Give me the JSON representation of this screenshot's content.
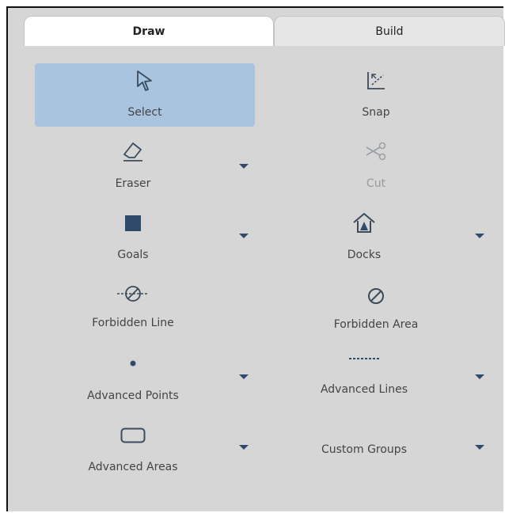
{
  "tabs": [
    {
      "label": "Draw",
      "active": true
    },
    {
      "label": "Build",
      "active": false
    }
  ],
  "tools": {
    "select": {
      "label": "Select",
      "icon": "cursor-arrow-icon",
      "selected": true
    },
    "snap": {
      "label": "Snap",
      "icon": "snap-icon"
    },
    "eraser": {
      "label": "Eraser",
      "icon": "eraser-icon",
      "has_dropdown": true
    },
    "cut": {
      "label": "Cut",
      "icon": "scissors-icon",
      "disabled": true
    },
    "goals": {
      "label": "Goals",
      "icon": "square-icon",
      "has_dropdown": true
    },
    "docks": {
      "label": "Docks",
      "icon": "dock-house-icon",
      "has_dropdown": true
    },
    "forbidden_line": {
      "label": "Forbidden Line",
      "icon": "forbidden-line-icon"
    },
    "forbidden_area": {
      "label": "Forbidden Area",
      "icon": "forbidden-area-icon"
    },
    "advanced_points": {
      "label": "Advanced Points",
      "icon": "point-icon",
      "has_dropdown": true
    },
    "advanced_lines": {
      "label": "Advanced Lines",
      "icon": "dashed-line-icon",
      "has_dropdown": true
    },
    "advanced_areas": {
      "label": "Advanced Areas",
      "icon": "rounded-rect-icon",
      "has_dropdown": true
    },
    "custom_groups": {
      "label": "Custom Groups",
      "has_dropdown": true
    }
  },
  "colors": {
    "panel_bg": "#d6d6d6",
    "selected_bg": "#a9c4df",
    "icon": "#3b4b5c",
    "caret": "#2f4a6a"
  }
}
